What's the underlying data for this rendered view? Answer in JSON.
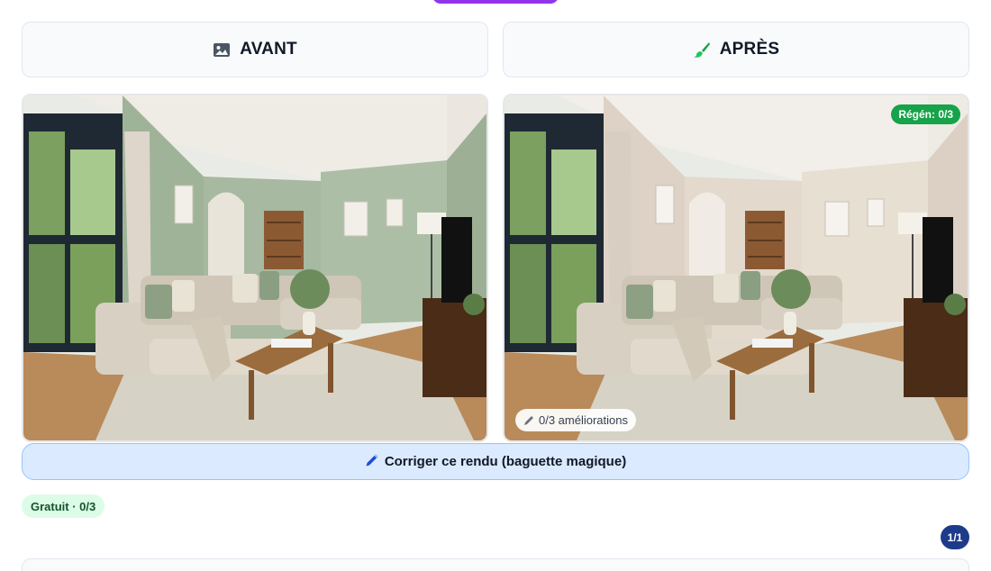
{
  "panels": {
    "before": {
      "label": "AVANT",
      "icon": "image-icon"
    },
    "after": {
      "label": "APRÈS",
      "icon": "paintbrush-icon"
    }
  },
  "after_image": {
    "regen_badge": "Régén: 0/3",
    "improvements_badge": "0/3 améliorations",
    "improvements_icon": "pencil-icon"
  },
  "actions": {
    "fix_button_label": "Corriger ce rendu (baguette magique)",
    "fix_button_icon": "pencil-icon"
  },
  "plan": {
    "badge": "Gratuit · 0/3"
  },
  "pagination": {
    "counter": "1/1"
  },
  "colors": {
    "before_wall": "#a9bba2",
    "after_wall": "#e6dcd0",
    "regen_green": "#16a34a",
    "fix_button_bg": "#dbeafe",
    "counter_navy": "#1e3a8a"
  }
}
